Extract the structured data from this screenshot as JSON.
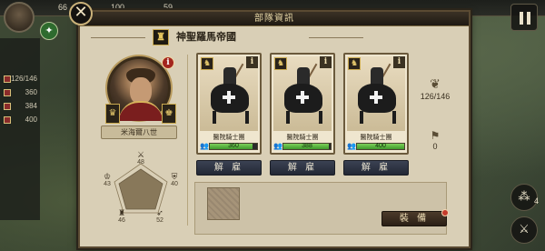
{
  "hud": {
    "res1": "66",
    "res2": "100",
    "res3": "59",
    "left_values": [
      "126/146",
      "360",
      "384",
      "400"
    ],
    "speed_count": "4"
  },
  "panel": {
    "title": "部隊資訊",
    "close_glyph": "✕",
    "faction_name": "神聖羅馬帝國",
    "faction_crest_glyph": "♜"
  },
  "general": {
    "name": "米海爾八世",
    "info_glyph": "i",
    "stats": {
      "attack": "48",
      "defense": "40",
      "leadership": "43",
      "mobility": "46",
      "tactics": "52"
    }
  },
  "units": [
    {
      "name": "醫院騎士團",
      "hp_value": "360",
      "hp_ratio": 0.9,
      "dismiss_label": "解 雇"
    },
    {
      "name": "醫院騎士團",
      "hp_value": "388",
      "hp_ratio": 0.97,
      "dismiss_label": "解 雇"
    },
    {
      "name": "醫院騎士團",
      "hp_value": "400",
      "hp_ratio": 1.0,
      "dismiss_label": "解 雇"
    }
  ],
  "troops": {
    "capacity": "126/146",
    "flags": "0"
  },
  "equip_label": "裝 備",
  "colors": {
    "panel_bg": "#d9cfb6",
    "hp_green": "#4fae37",
    "button_navy": "#2c3240",
    "alert_red": "#a3251d"
  },
  "icons": {
    "close": "close-icon",
    "pause": "pause-icon",
    "crest": "eagle-crest-icon",
    "people": "people-icon",
    "wings": "wings-icon",
    "flag": "banner-icon"
  }
}
